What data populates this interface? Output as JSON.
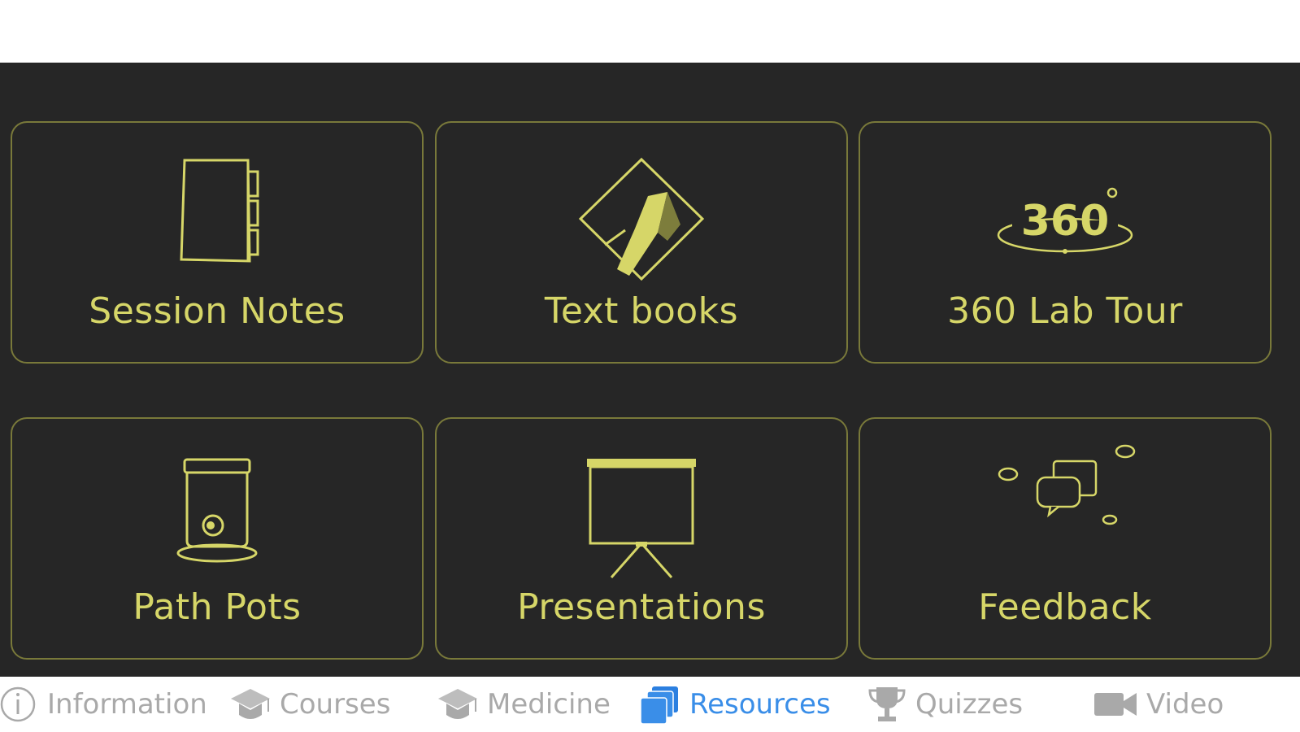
{
  "colors": {
    "panel_background": "#262626",
    "tile_border": "#79793a",
    "tile_accent": "#d6d668",
    "tab_inactive": "#a9a9a9",
    "tab_active": "#3a8ee8"
  },
  "tiles": [
    {
      "label": "Session Notes",
      "icon": "notebook-icon"
    },
    {
      "label": "Text books",
      "icon": "textbook-diamond-icon"
    },
    {
      "label": "360 Lab Tour",
      "icon": "360-view-icon"
    },
    {
      "label": "Path Pots",
      "icon": "specimen-jar-icon"
    },
    {
      "label": "Presentations",
      "icon": "projector-screen-icon"
    },
    {
      "label": "Feedback",
      "icon": "chat-bubbles-icon"
    }
  ],
  "tab_bar": {
    "active": "Resources",
    "items": [
      {
        "label": "Information",
        "icon": "info-icon"
      },
      {
        "label": "Courses",
        "icon": "graduation-cap-icon"
      },
      {
        "label": "Medicine",
        "icon": "graduation-cap-icon"
      },
      {
        "label": "Resources",
        "icon": "stacked-squares-icon"
      },
      {
        "label": "Quizzes",
        "icon": "trophy-icon"
      },
      {
        "label": "Video",
        "icon": "video-camera-icon"
      }
    ]
  }
}
